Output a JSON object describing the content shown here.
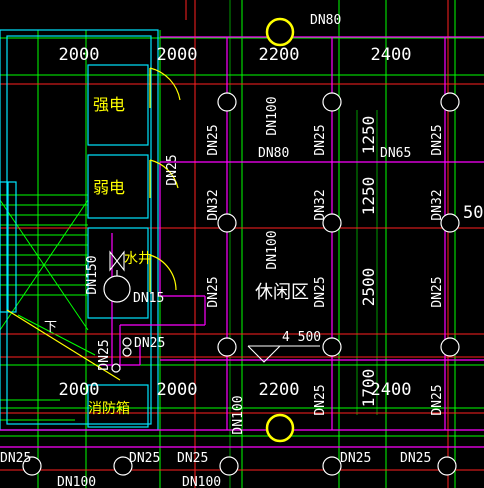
{
  "colors": {
    "background": "#000000",
    "grid": "#00ff00",
    "wall": "#ff2020",
    "pipe": "#ff00ff",
    "text_white": "#ffffff",
    "text_yellow": "#ffff00",
    "fixture": "#00ffff",
    "door": "#ffff00"
  },
  "dimensions": {
    "top_row": [
      "2000",
      "2000",
      "2200",
      "2400"
    ],
    "bottom_row": [
      "2000",
      "2000",
      "2200",
      "2400"
    ],
    "vertical": [
      "1250",
      "1250",
      "2500",
      "1700"
    ],
    "span_4500": "4 500"
  },
  "pipe_labels": {
    "dn80_top": "DN80",
    "dn80_mid": "DN80",
    "dn65": "DN65",
    "dn100_a": "DN100",
    "dn100_b": "DN100",
    "dn100_c": "DN100",
    "dn100_bottom_a": "DN100",
    "dn100_bottom_b": "DN100",
    "dn150": "DN150",
    "dn25_1": "DN25",
    "dn25_2": "DN25",
    "dn25_3": "DN25",
    "dn25_4": "DN25",
    "dn25_5": "DN25",
    "dn25_6": "DN25",
    "dn25_7": "DN25",
    "dn25_8": "DN25",
    "dn25_9": "DN25",
    "dn25_10": "DN25",
    "dn25_11": "DN25",
    "dn25_12": "DN25",
    "dn25_13": "DN25",
    "dn25_14": "DN25",
    "dn25_15": "DN25",
    "dn25_16": "DN25",
    "dn32_1": "DN32",
    "dn32_2": "DN32",
    "dn32_3": "DN32",
    "dn15": "DN15",
    "partial_500": "500"
  },
  "rooms": {
    "strong_power": "强电",
    "weak_power": "弱电",
    "water_well": "水井",
    "fire_box": "消防箱",
    "lounge": "休闲区",
    "stair_down": "下"
  }
}
